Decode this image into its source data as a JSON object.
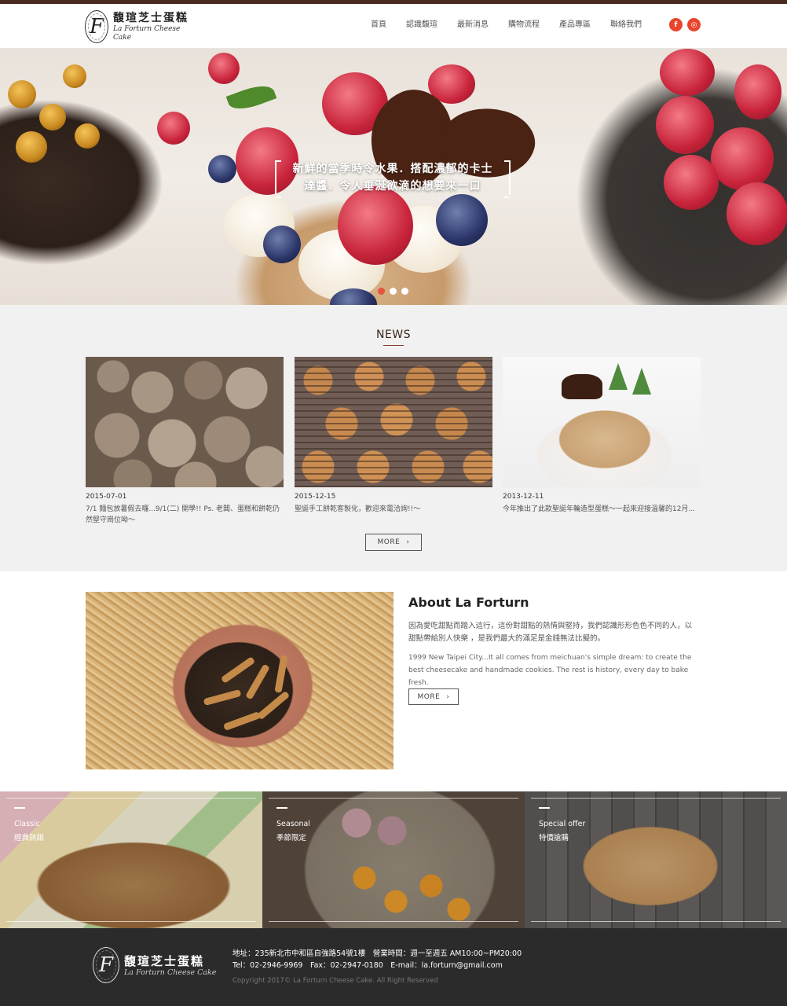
{
  "brand": {
    "name_zh": "馥瑄芝士蛋糕",
    "name_en": "La Forturn Cheese Cake",
    "logo_letter": "F"
  },
  "nav": {
    "items": [
      {
        "label": "首頁"
      },
      {
        "label": "認識馥瑄"
      },
      {
        "label": "最新消息"
      },
      {
        "label": "購物流程"
      },
      {
        "label": "產品專區"
      },
      {
        "label": "聯絡我們"
      }
    ],
    "social": [
      {
        "icon": "facebook-icon",
        "glyph": "f"
      },
      {
        "icon": "instagram-icon",
        "glyph": "◎"
      }
    ]
  },
  "hero": {
    "caption_line1": "新鮮的當季時令水果．搭配濃郁的卡士",
    "caption_line2": "達醬．令人垂涎欲滴的想要來一口",
    "slides": 3,
    "active_slide": 1
  },
  "news": {
    "title": "NEWS",
    "items": [
      {
        "date": "2015-07-01",
        "text": "7/1 麵包放暑假去囉...9/1(二) 開學!! Ps. 老闆、蛋糕和餅乾仍然堅守崗位呦～"
      },
      {
        "date": "2015-12-15",
        "text": "聖誕手工餅乾客製化，歡迎來電洽詢!!～"
      },
      {
        "date": "2013-12-11",
        "text": "今年推出了此款聖誕年輪造型蛋糕～一起來迎接溫馨的12月..."
      }
    ],
    "more_label": "MORE"
  },
  "about": {
    "title": "About La Forturn",
    "text_zh": "因為愛吃甜點而踏入這行，這份對甜點的熱情與堅持，我們認識形形色色不同的人，以甜點帶給別人快樂 ，是我們最大的滿足是金錢無法比擬的。",
    "text_en": "1999 New Taipei City...It all comes from meichuan's simple dream: to create the best cheesecake and handmade cookies. The rest is history, every day to bake fresh.",
    "more_label": "MORE"
  },
  "categories": [
    {
      "en": "Classic",
      "zh": "經典熱銷"
    },
    {
      "en": "Seasonal",
      "zh": "季節限定"
    },
    {
      "en": "Special offer",
      "zh": "特價搶購"
    }
  ],
  "footer": {
    "address": "地址：235新北市中和區自強路54號1樓　營業時間：週一至週五 AM10:00~PM20:00",
    "contact": "Tel：02-2946-9969　Fax：02-2947-0180　E-mail：la.forturn@gmail.com",
    "copyright": "Copyright 2017© La Forturn Cheese Cake. All Right Reserved"
  },
  "colors": {
    "accent": "#e8452c",
    "brand_dark": "#4a2a1e",
    "footer_bg": "#2b2b2b",
    "news_bg": "#f1f1f1"
  }
}
